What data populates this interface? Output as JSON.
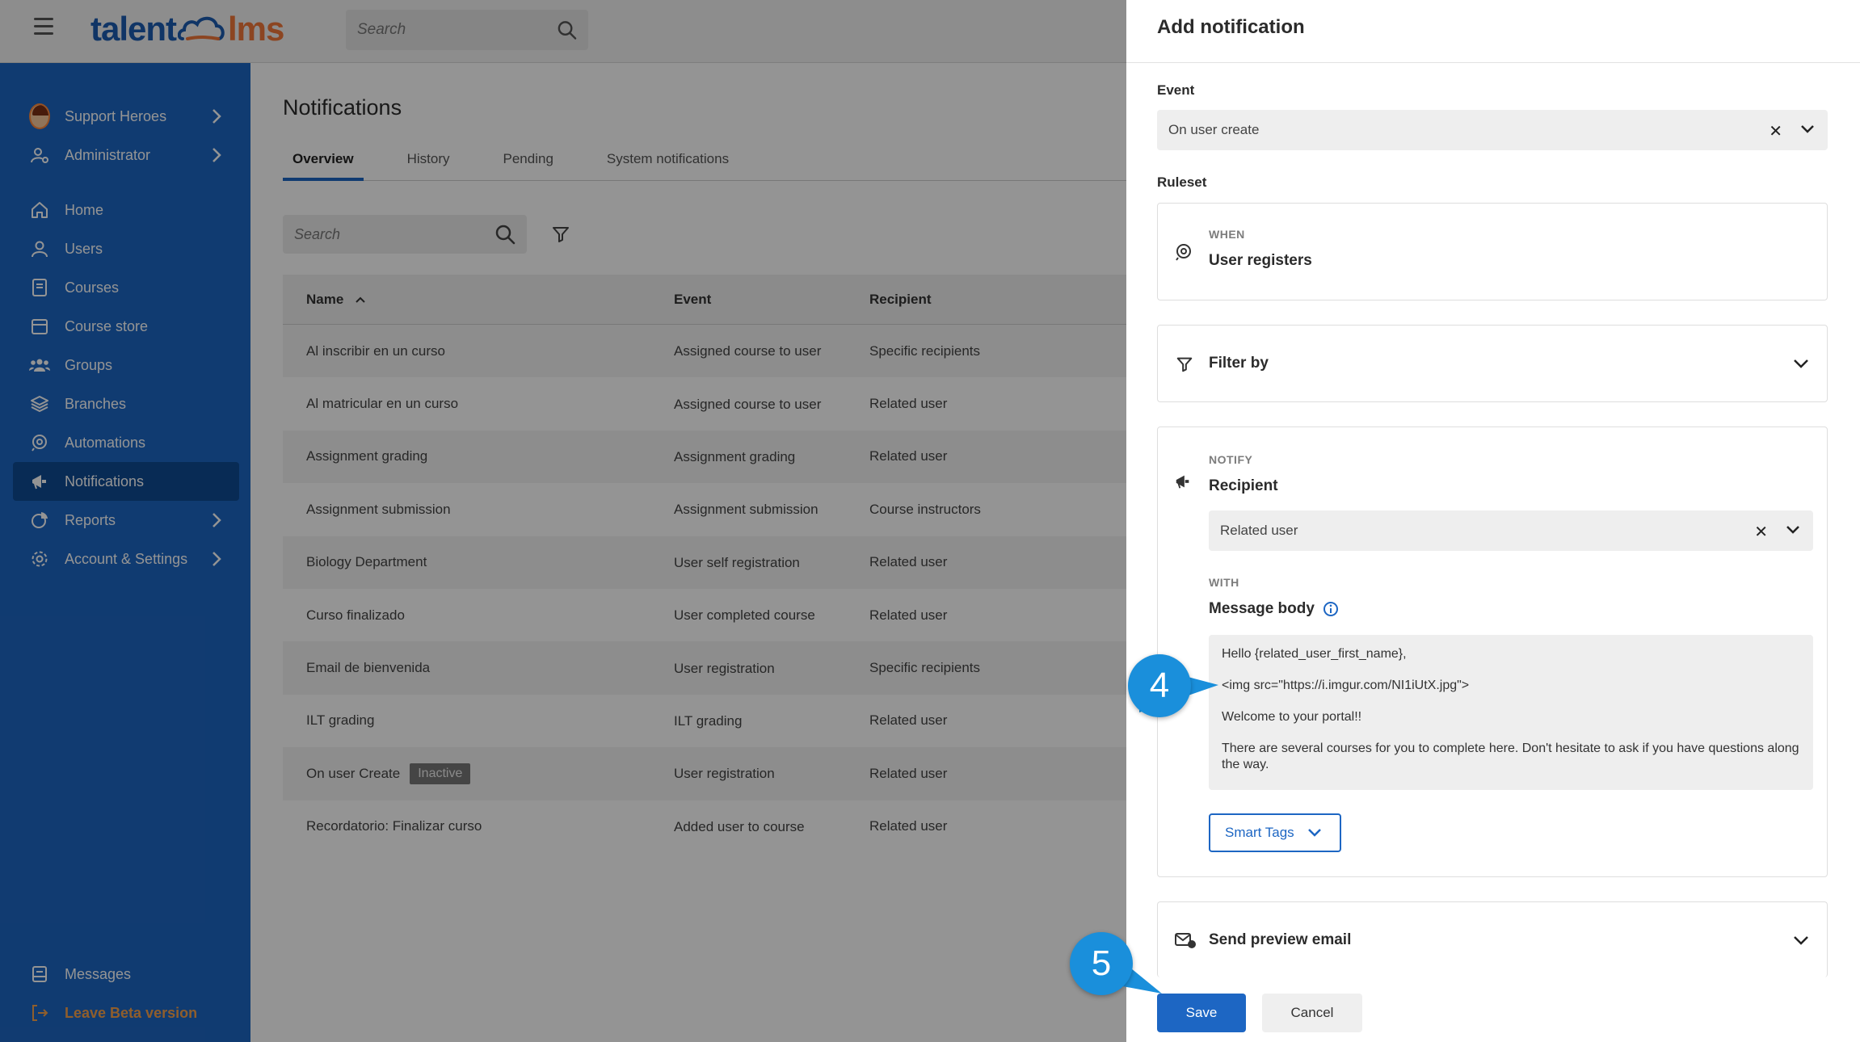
{
  "topbar": {
    "logo_talent": "talent",
    "logo_lms": "lms",
    "search_placeholder": "Search"
  },
  "sidebar": {
    "items": [
      {
        "label": "Support Heroes",
        "icon": "avatar"
      },
      {
        "label": "Administrator",
        "icon": "user-cog-icon"
      },
      {
        "label": "Home",
        "icon": "home-icon"
      },
      {
        "label": "Users",
        "icon": "user-icon"
      },
      {
        "label": "Courses",
        "icon": "book-icon"
      },
      {
        "label": "Course store",
        "icon": "store-icon"
      },
      {
        "label": "Groups",
        "icon": "group-icon"
      },
      {
        "label": "Branches",
        "icon": "layers-icon"
      },
      {
        "label": "Automations",
        "icon": "automation-icon"
      },
      {
        "label": "Notifications",
        "icon": "megaphone-icon"
      },
      {
        "label": "Reports",
        "icon": "pie-chart-icon"
      },
      {
        "label": "Account & Settings",
        "icon": "gear-icon"
      }
    ],
    "bottom": [
      {
        "label": "Messages",
        "icon": "message-icon"
      },
      {
        "label": "Leave Beta version",
        "icon": "exit-icon"
      }
    ],
    "colors": {
      "background": "#1d66c3",
      "active": "#0e4a93",
      "beta": "#f7a24c"
    }
  },
  "main": {
    "title": "Notifications",
    "tabs": [
      "Overview",
      "History",
      "Pending",
      "System notifications"
    ],
    "search_placeholder": "Search",
    "table": {
      "headers": [
        "Name",
        "Event",
        "Recipient"
      ],
      "rows": [
        {
          "name": "Al inscribir en un curso",
          "event": "Assigned course to user",
          "recipient": "Specific recipients",
          "badge": ""
        },
        {
          "name": "Al matricular en un curso",
          "event": "Assigned course to user",
          "recipient": "Related user",
          "badge": ""
        },
        {
          "name": "Assignment grading",
          "event": "Assignment grading",
          "recipient": "Related user",
          "badge": ""
        },
        {
          "name": "Assignment submission",
          "event": "Assignment submission",
          "recipient": "Course instructors",
          "badge": ""
        },
        {
          "name": "Biology Department",
          "event": "User self registration",
          "recipient": "Related user",
          "badge": ""
        },
        {
          "name": "Curso finalizado",
          "event": "User completed course",
          "recipient": "Related user",
          "badge": ""
        },
        {
          "name": "Email de bienvenida",
          "event": "User registration",
          "recipient": "Specific recipients",
          "badge": ""
        },
        {
          "name": "ILT grading",
          "event": "ILT grading",
          "recipient": "Related user",
          "badge": ""
        },
        {
          "name": "On user Create",
          "event": "User registration",
          "recipient": "Related user",
          "badge": "Inactive"
        },
        {
          "name": "Recordatorio: Finalizar curso",
          "event": "Added user to course",
          "recipient": "Related user",
          "badge": ""
        }
      ]
    }
  },
  "panel": {
    "title": "Add notification",
    "event_label": "Event",
    "event_value": "On user create",
    "ruleset_label": "Ruleset",
    "when_caption": "WHEN",
    "when_value": "User registers",
    "filter_label": "Filter by",
    "notify_caption": "NOTIFY",
    "recipient_label": "Recipient",
    "recipient_value": "Related user",
    "with_caption": "WITH",
    "message_label": "Message body",
    "message_lines": [
      "Hello {related_user_first_name},",
      "<img src=\"https://i.imgur.com/NI1iUtX.jpg\">",
      "Welcome to your portal!!",
      "There are several courses for you to complete here. Don't hesitate to ask if you have questions along the way."
    ],
    "smart_tags_label": "Smart Tags",
    "send_preview_label": "Send preview email",
    "save_label": "Save",
    "cancel_label": "Cancel"
  },
  "annotations": {
    "step4": "4",
    "step5": "5",
    "color": "#1a8fdb"
  }
}
